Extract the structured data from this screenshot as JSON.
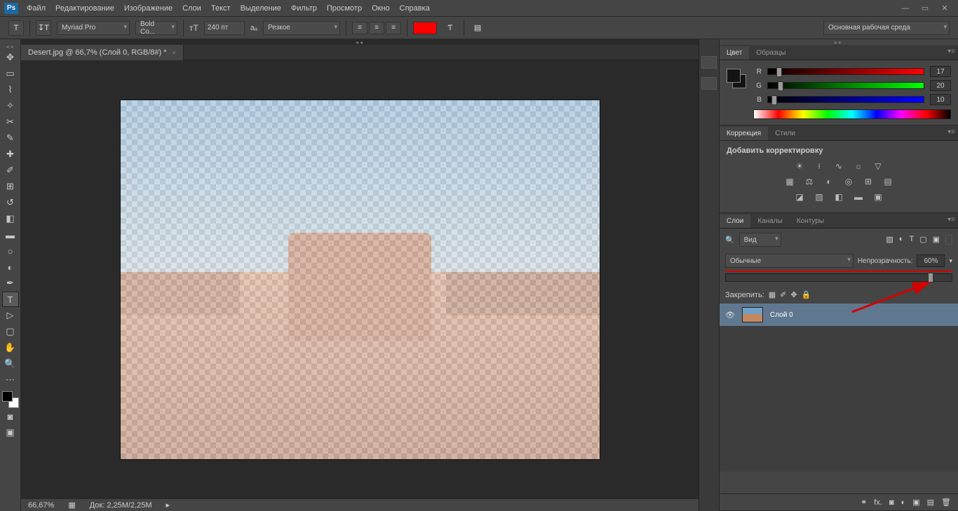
{
  "menubar": [
    "Файл",
    "Редактирование",
    "Изображение",
    "Слои",
    "Текст",
    "Выделение",
    "Фильтр",
    "Просмотр",
    "Окно",
    "Справка"
  ],
  "options": {
    "font_family": "Myriad Pro",
    "font_style": "Bold Co...",
    "font_size": "240 пт",
    "antialias": "Резкое",
    "workspace": "Основная рабочая среда"
  },
  "doc_tab": "Desert.jpg @ 66,7% (Слой 0, RGB/8#) *",
  "status": {
    "zoom": "66,67%",
    "doc": "Док: 2,25M/2,25M"
  },
  "color_panel": {
    "tabs": [
      "Цвет",
      "Образцы"
    ],
    "r": "17",
    "g": "20",
    "b": "10"
  },
  "adjust_panel": {
    "tabs": [
      "Коррекция",
      "Стили"
    ],
    "title": "Добавить корректировку"
  },
  "layers_panel": {
    "tabs": [
      "Слои",
      "Каналы",
      "Контуры"
    ],
    "filter": "Вид",
    "blend": "Обычные",
    "opacity_label": "Непрозрачность:",
    "opacity": "60%",
    "lock_label": "Закрепить:",
    "layer_name": "Слой 0"
  }
}
